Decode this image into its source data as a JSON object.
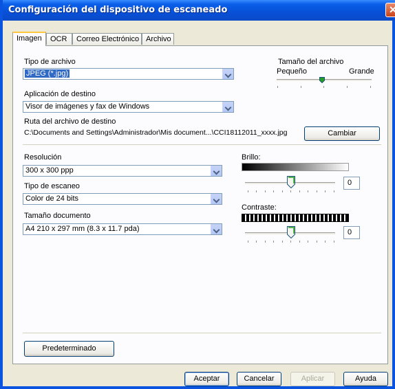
{
  "window": {
    "title": "Configuración del dispositivo de escaneado",
    "close_label": "✕"
  },
  "tabs": [
    "Imagen",
    "OCR",
    "Correo Electrónico",
    "Archivo"
  ],
  "active_tab": "Imagen",
  "file_type": {
    "label": "Tipo de archivo",
    "value": "JPEG (*.jpg)"
  },
  "file_size": {
    "label": "Tamaño del archivo",
    "min_label": "Pequeño",
    "max_label": "Grande",
    "level_fraction": 0.5
  },
  "target_app": {
    "label": "Aplicación de destino",
    "value": "Visor de imágenes y fax de Windows"
  },
  "target_path": {
    "label": "Ruta del archivo de destino",
    "value": "C:\\Documents and Settings\\Administrador\\Mis document...\\CCI18112011_xxxx.jpg",
    "change_button": "Cambiar"
  },
  "resolution": {
    "label": "Resolución",
    "value": "300 x 300 ppp"
  },
  "scan_type": {
    "label": "Tipo de escaneo",
    "value": "Color de 24 bits"
  },
  "doc_size": {
    "label": "Tamaño documento",
    "value": "A4 210 x 297 mm (8.3 x 11.7 pda)"
  },
  "brightness": {
    "label": "Brillo:",
    "value": "0",
    "level_fraction": 0.5
  },
  "contrast": {
    "label": "Contraste:",
    "value": "0",
    "level_fraction": 0.5
  },
  "buttons": {
    "default": "Predeterminado",
    "ok": "Aceptar",
    "cancel": "Cancelar",
    "apply": "Aplicar",
    "help": "Ayuda"
  },
  "colors": {
    "titlebar": "#0A5FE8",
    "selection": "#316AC5",
    "tab_highlight": "#FFC83C",
    "dialog_bg": "#ECE9D8"
  }
}
